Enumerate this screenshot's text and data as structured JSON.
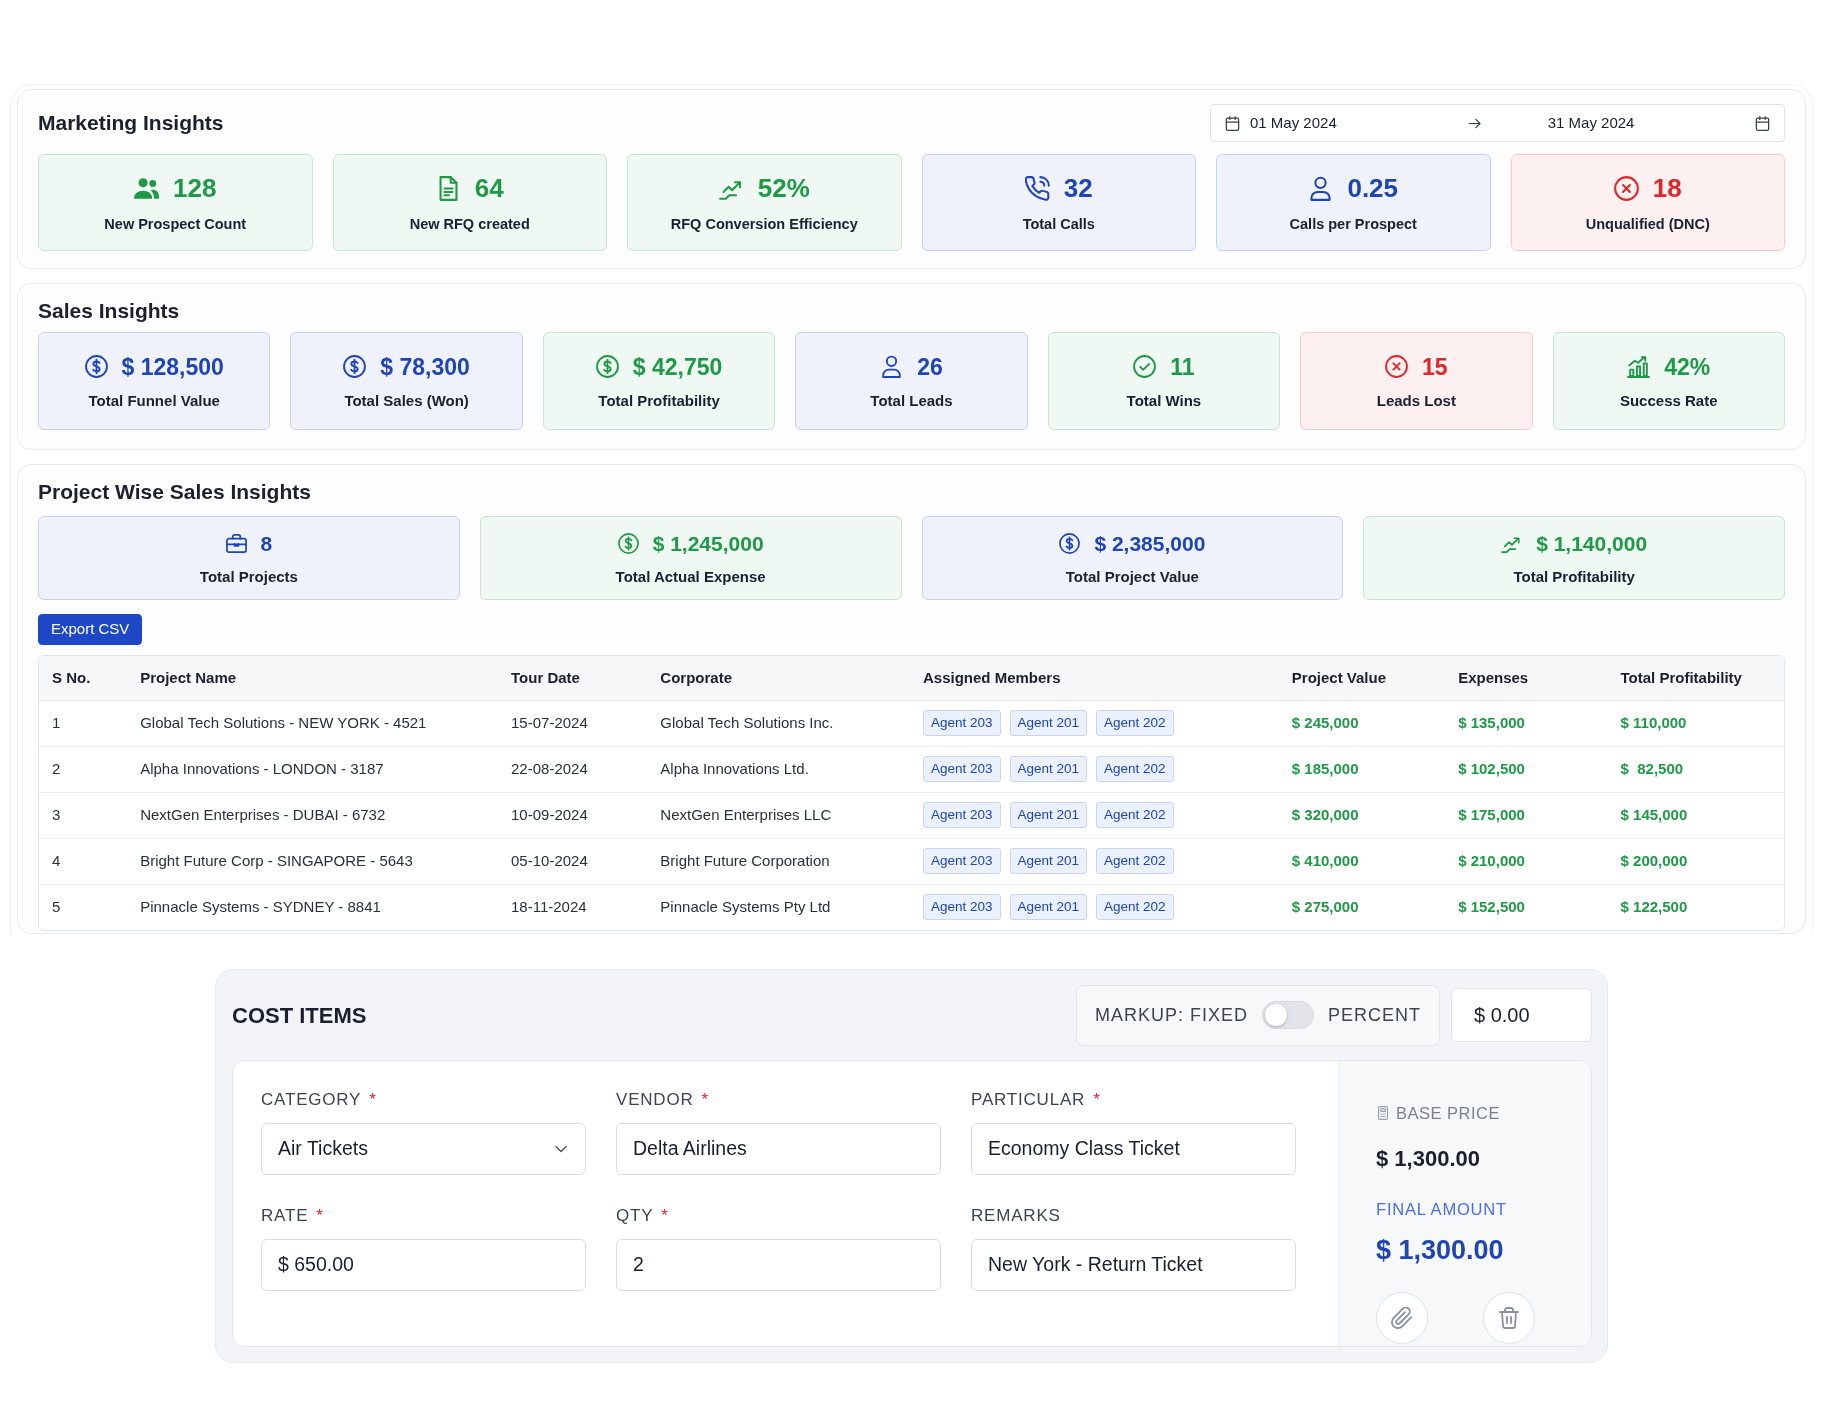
{
  "marketing": {
    "title": "Marketing Insights",
    "date_range": {
      "start": "01 May 2024",
      "end": "31 May 2024"
    },
    "metrics": [
      {
        "kind": "prospects",
        "value": "128",
        "label": "New Prospect Count",
        "color": "#1e9a46"
      },
      {
        "kind": "rfq",
        "value": "64",
        "label": "New RFQ created",
        "color": "#1e9a46"
      },
      {
        "kind": "conversion",
        "value": "52%",
        "label": "RFQ Conversion Efficiency",
        "color": "#1e9a46"
      },
      {
        "kind": "calls",
        "value": "32",
        "label": "Total Calls",
        "color": "#1f45b5"
      },
      {
        "kind": "person",
        "value": "0.25",
        "label": "Calls per Prospect",
        "color": "#1f45b5"
      },
      {
        "kind": "rejected",
        "value": "18",
        "label": "Unqualified (DNC)",
        "color": "#e0262a"
      }
    ]
  },
  "sales": {
    "title": "Sales Insights",
    "metrics": [
      {
        "kind": "money",
        "value": "$ 128,500",
        "label": "Total Funnel Value",
        "color": "#1f45b5"
      },
      {
        "kind": "money",
        "value": "$ 78,300",
        "label": "Total Sales (Won)",
        "color": "#1f45b5"
      },
      {
        "kind": "money",
        "value": "$ 42,750",
        "label": "Total Profitability",
        "color": "#1e9a46"
      },
      {
        "kind": "person",
        "value": "26",
        "label": "Total Leads",
        "color": "#1f45b5"
      },
      {
        "kind": "wins",
        "value": "11",
        "label": "Total Wins",
        "color": "#1e9a46"
      },
      {
        "kind": "rejected",
        "value": "15",
        "label": "Leads Lost",
        "color": "#e0262a"
      },
      {
        "kind": "success",
        "value": "42%",
        "label": "Success Rate",
        "color": "#1e9a46"
      }
    ]
  },
  "projects": {
    "title": "Project Wise Sales Insights",
    "metrics": [
      {
        "kind": "projects",
        "value": "8",
        "label": "Total Projects",
        "color": "#1f45b5"
      },
      {
        "kind": "money",
        "value": "$ 1,245,000",
        "label": "Total Actual Expense",
        "color": "#1e9a46"
      },
      {
        "kind": "money",
        "value": "$ 2,385,000",
        "label": "Total Project Value",
        "color": "#1f45b5"
      },
      {
        "kind": "conversion",
        "value": "$ 1,140,000",
        "label": "Total Profitability",
        "color": "#1e9a46"
      }
    ],
    "export_button": "Export CSV",
    "table": {
      "columns": [
        "S No.",
        "Project Name",
        "Tour Date",
        "Corporate",
        "Assigned Members",
        "Project Value",
        "Expenses",
        "Total Profitability"
      ],
      "rows": [
        {
          "s_no": "1",
          "project_name": "Global Tech Solutions - NEW YORK - 4521",
          "tour_date": "15-07-2024",
          "corporate": "Global Tech Solutions Inc.",
          "members": [
            "Agent 203",
            "Agent 201",
            "Agent 202"
          ],
          "project_value": "$ 245,000",
          "expenses": "$ 135,000",
          "total_profitability": "$ 110,000"
        },
        {
          "s_no": "2",
          "project_name": "Alpha Innovations - LONDON - 3187",
          "tour_date": "22-08-2024",
          "corporate": "Alpha Innovations Ltd.",
          "members": [
            "Agent 203",
            "Agent 201",
            "Agent 202"
          ],
          "project_value": "$ 185,000",
          "expenses": "$ 102,500",
          "total_profitability": "$  82,500"
        },
        {
          "s_no": "3",
          "project_name": "NextGen Enterprises - DUBAI - 6732",
          "tour_date": "10-09-2024",
          "corporate": "NextGen Enterprises LLC",
          "members": [
            "Agent 203",
            "Agent 201",
            "Agent 202"
          ],
          "project_value": "$ 320,000",
          "expenses": "$ 175,000",
          "total_profitability": "$ 145,000"
        },
        {
          "s_no": "4",
          "project_name": "Bright Future Corp - SINGAPORE - 5643",
          "tour_date": "05-10-2024",
          "corporate": "Bright Future Corporation",
          "members": [
            "Agent 203",
            "Agent 201",
            "Agent 202"
          ],
          "project_value": "$ 410,000",
          "expenses": "$ 210,000",
          "total_profitability": "$ 200,000"
        },
        {
          "s_no": "5",
          "project_name": "Pinnacle Systems - SYDNEY - 8841",
          "tour_date": "18-11-2024",
          "corporate": "Pinnacle Systems Pty Ltd",
          "members": [
            "Agent 203",
            "Agent 201",
            "Agent 202"
          ],
          "project_value": "$ 275,000",
          "expenses": "$ 152,500",
          "total_profitability": "$ 122,500"
        }
      ]
    }
  },
  "cost_items": {
    "title": "COST ITEMS",
    "markup": {
      "fixed_label": "MARKUP: FIXED",
      "percent_label": "PERCENT",
      "on": false,
      "value": "$ 0.00"
    },
    "fields": [
      {
        "kind": "select",
        "label": "CATEGORY",
        "required_mark": "*",
        "value": "Air Tickets"
      },
      {
        "kind": "text",
        "label": "VENDOR",
        "required_mark": "*",
        "value": "Delta Airlines"
      },
      {
        "kind": "text",
        "label": "PARTICULAR",
        "required_mark": "*",
        "value": "Economy Class Ticket"
      },
      {
        "kind": "text",
        "label": "RATE",
        "required_mark": "*",
        "value": "$ 650.00"
      },
      {
        "kind": "text",
        "label": "QTY",
        "required_mark": "*",
        "value": "2"
      },
      {
        "kind": "text",
        "label": "REMARKS",
        "value": "New York - Return Ticket"
      }
    ],
    "summary": {
      "base_label": "BASE PRICE",
      "base_value": "$ 1,300.00",
      "final_label": "FINAL AMOUNT",
      "final_value": "$ 1,300.00"
    }
  }
}
